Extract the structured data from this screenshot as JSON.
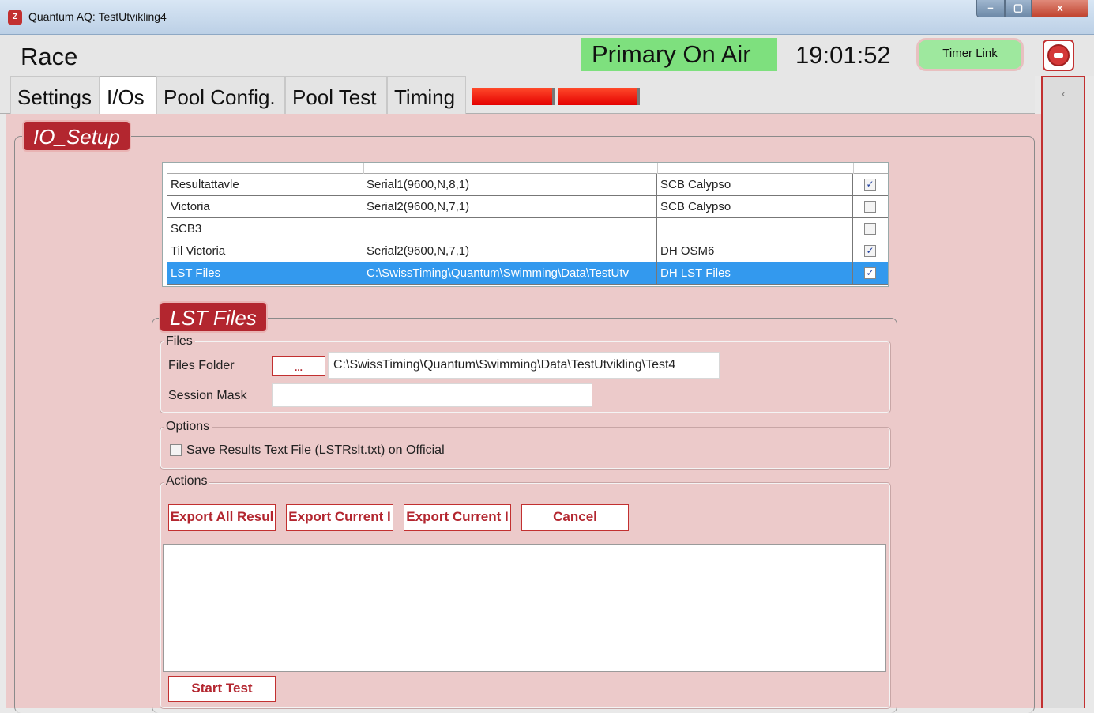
{
  "window": {
    "title": "Quantum AQ: TestUtvikling4",
    "controls": {
      "minimize": "–",
      "maximize": "▢",
      "close": "x"
    }
  },
  "header": {
    "section": "Race",
    "status": "Primary On Air",
    "clock": "19:01:52",
    "timer_link": "Timer Link"
  },
  "tabs": [
    {
      "label": "Settings",
      "selected": false
    },
    {
      "label": "I/Os",
      "selected": true
    },
    {
      "label": "Pool Config.",
      "selected": false
    },
    {
      "label": "Pool Test",
      "selected": false
    },
    {
      "label": "Timing",
      "selected": false
    }
  ],
  "sidebar": {
    "collapse_glyph": "‹"
  },
  "io_setup": {
    "title": "IO_Setup",
    "rows": [
      {
        "name": "Resultattavle",
        "port": "Serial1(9600,N,8,1)",
        "device": "SCB Calypso",
        "enabled": true
      },
      {
        "name": "Victoria",
        "port": "Serial2(9600,N,7,1)",
        "device": "SCB Calypso",
        "enabled": false
      },
      {
        "name": "SCB3",
        "port": "",
        "device": "",
        "enabled": false
      },
      {
        "name": "Til Victoria",
        "port": "Serial2(9600,N,7,1)",
        "device": "DH OSM6",
        "enabled": true
      },
      {
        "name": "LST Files",
        "port": "C:\\SwissTiming\\Quantum\\Swimming\\Data\\TestUtv",
        "device": "DH LST Files",
        "enabled": true,
        "selected": true
      }
    ]
  },
  "lst_files": {
    "title": "LST Files",
    "files": {
      "title": "Files",
      "folder_label": "Files Folder",
      "browse_label": "...",
      "folder_value": "C:\\SwissTiming\\Quantum\\Swimming\\Data\\TestUtvikling\\Test4",
      "mask_label": "Session Mask",
      "mask_value": ""
    },
    "options": {
      "title": "Options",
      "save_results_label": "Save Results Text File (LSTRslt.txt) on Official",
      "save_results_checked": false
    },
    "actions": {
      "title": "Actions",
      "export_all": "Export All Resul",
      "export_current_1": "Export Current I",
      "export_current_2": "Export Current I",
      "cancel": "Cancel",
      "log": "",
      "start_test": "Start Test"
    }
  }
}
